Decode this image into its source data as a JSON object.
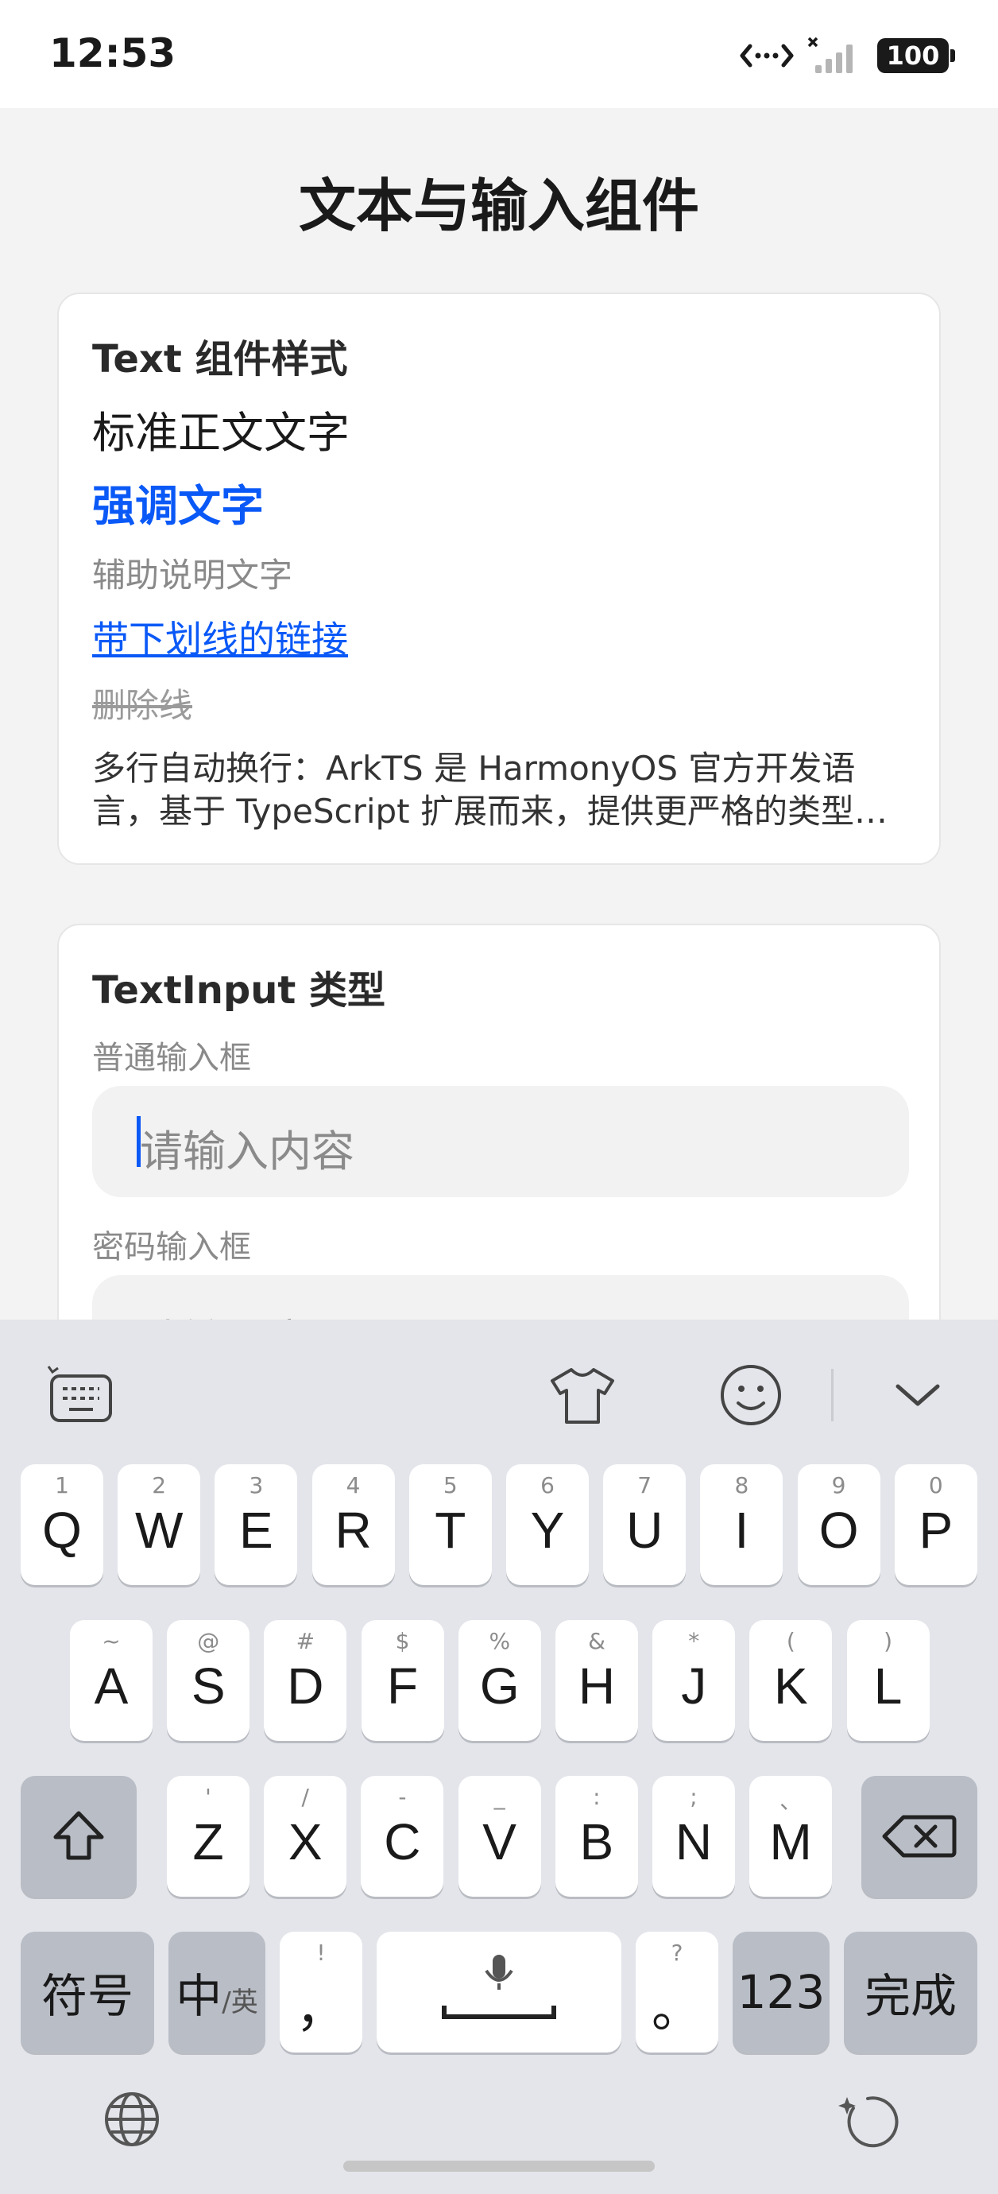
{
  "status_bar": {
    "time": "12:53",
    "battery": "100"
  },
  "page": {
    "title": "文本与输入组件"
  },
  "text_card": {
    "title": "Text 组件样式",
    "normal": "标准正文文字",
    "emphasis": "强调文字",
    "auxiliary": "辅助说明文字",
    "link": "带下划线的链接",
    "strikethrough": "删除线",
    "multiline": "多行自动换行：ArkTS 是 HarmonyOS 官方开发语言，基于 TypeScript 扩展而来，提供更严格的类型检查与声明式 UI 能力。"
  },
  "input_card": {
    "title": "TextInput 类型",
    "normal_label": "普通输入框",
    "normal_placeholder": "请输入内容",
    "password_label": "密码输入框",
    "password_placeholder": "请输入密码"
  },
  "keyboard": {
    "row1": [
      {
        "hint": "1",
        "key": "Q"
      },
      {
        "hint": "2",
        "key": "W"
      },
      {
        "hint": "3",
        "key": "E"
      },
      {
        "hint": "4",
        "key": "R"
      },
      {
        "hint": "5",
        "key": "T"
      },
      {
        "hint": "6",
        "key": "Y"
      },
      {
        "hint": "7",
        "key": "U"
      },
      {
        "hint": "8",
        "key": "I"
      },
      {
        "hint": "9",
        "key": "O"
      },
      {
        "hint": "0",
        "key": "P"
      }
    ],
    "row2": [
      {
        "hint": "~",
        "key": "A"
      },
      {
        "hint": "@",
        "key": "S"
      },
      {
        "hint": "#",
        "key": "D"
      },
      {
        "hint": "$",
        "key": "F"
      },
      {
        "hint": "%",
        "key": "G"
      },
      {
        "hint": "&",
        "key": "H"
      },
      {
        "hint": "*",
        "key": "J"
      },
      {
        "hint": "(",
        "key": "K"
      },
      {
        "hint": ")",
        "key": "L"
      }
    ],
    "row3": [
      {
        "hint": "'",
        "key": "Z"
      },
      {
        "hint": "/",
        "key": "X"
      },
      {
        "hint": "-",
        "key": "C"
      },
      {
        "hint": "_",
        "key": "V"
      },
      {
        "hint": ":",
        "key": "B"
      },
      {
        "hint": ";",
        "key": "N"
      },
      {
        "hint": "、",
        "key": "M"
      }
    ],
    "symbols": "符号",
    "lang_main": "中",
    "lang_sub": "/英",
    "comma_hint": "!",
    "comma": "，",
    "period_hint": "?",
    "period": "。",
    "num": "123",
    "done": "完成"
  },
  "icons": [
    "keyboard-settings-icon",
    "skin-icon",
    "emoji-icon",
    "collapse-icon",
    "shift-icon",
    "backspace-icon",
    "mic-icon",
    "globe-icon",
    "ai-assist-icon",
    "signal-icon",
    "data-transfer-icon"
  ],
  "colors": {
    "accent": "#0a59f7",
    "background": "#f3f3f3",
    "keyboard_bg": "#e3e5ea"
  }
}
